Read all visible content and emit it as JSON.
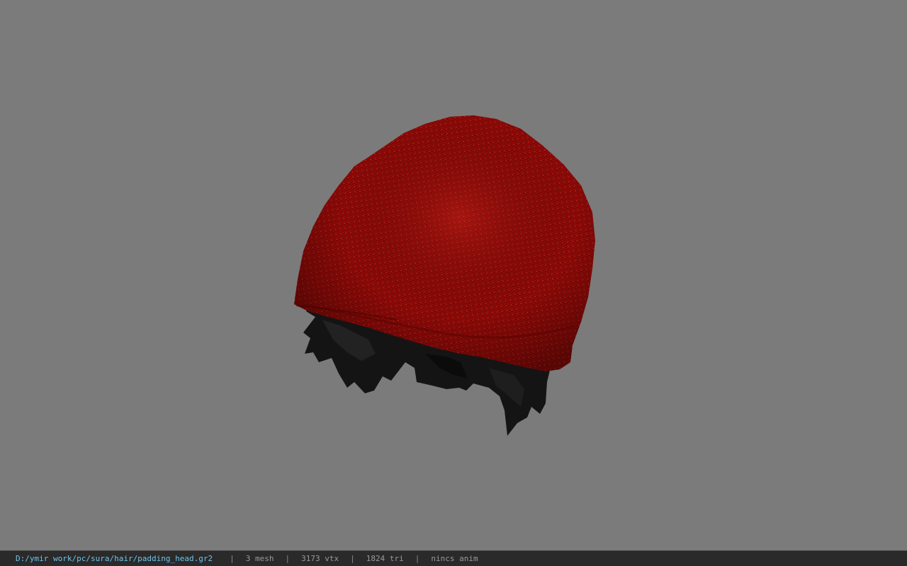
{
  "viewport": {
    "background_color": "#7b7b7b",
    "model": {
      "hat_color": "#a50e0b",
      "hair_color": "#151515"
    }
  },
  "statusbar": {
    "file_path": "D:/ymir work/pc/sura/hair/padding_head.gr2",
    "separator": "|",
    "mesh_count": "3 mesh",
    "vertex_count": "3173 vtx",
    "triangle_count": "1824 tri",
    "anim_status": "nincs anim",
    "path_color": "#6fc3e8"
  }
}
